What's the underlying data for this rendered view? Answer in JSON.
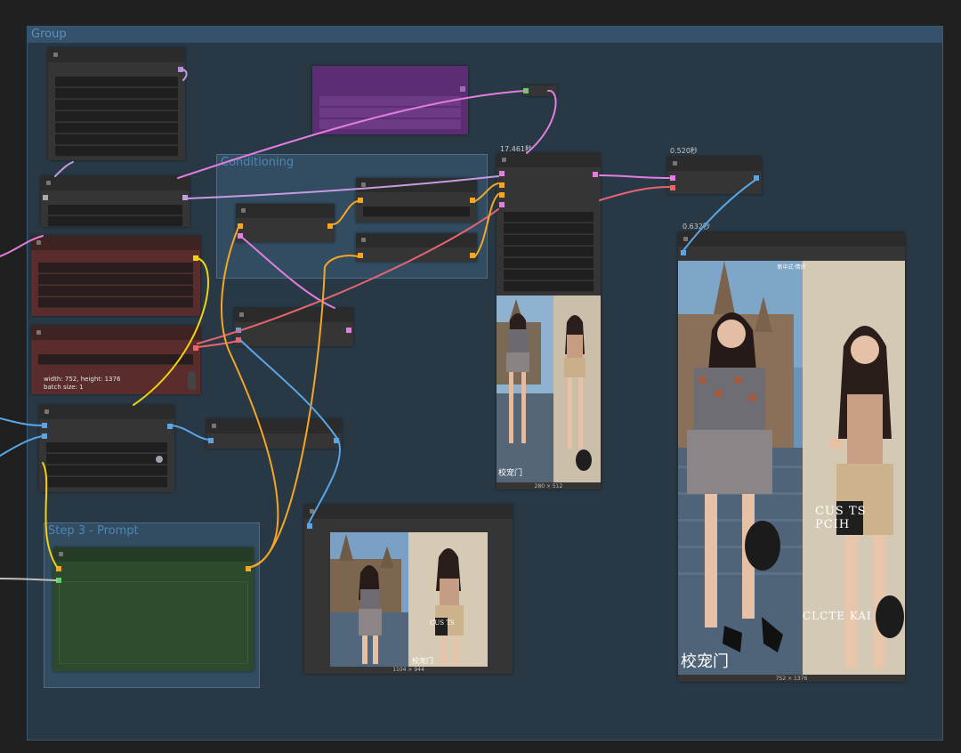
{
  "groups": {
    "main": "Group",
    "conditioning": "Conditioning",
    "prompt": "Step 3 - Prompt"
  },
  "timings": {
    "sampler": "17.461秒",
    "vae_decode": "0.520秒",
    "save_node": "0.632秒"
  },
  "latent_node": {
    "info_line1": "width: 752, height: 1376",
    "info_line2": "batch size: 1"
  },
  "previews": {
    "small_size": "280 × 512",
    "mid_size": "1104 × 944",
    "large_size": "752 × 1376",
    "large_caption": "新中式·情侣",
    "signature": "校宠门",
    "brand_large_1": "CUS TS PCIH",
    "brand_large_2": "CLCTE KAI",
    "brand_mid": "CUS TS"
  },
  "colors": {
    "link_pink": "#e27ee0",
    "link_orange": "#f5a623",
    "link_yellow": "#f1d20d",
    "link_blue": "#5aa5e6",
    "link_red": "#e8646f",
    "link_white": "#bfbfbf",
    "group_bg": "#293a48",
    "node_bg": "#353535"
  }
}
